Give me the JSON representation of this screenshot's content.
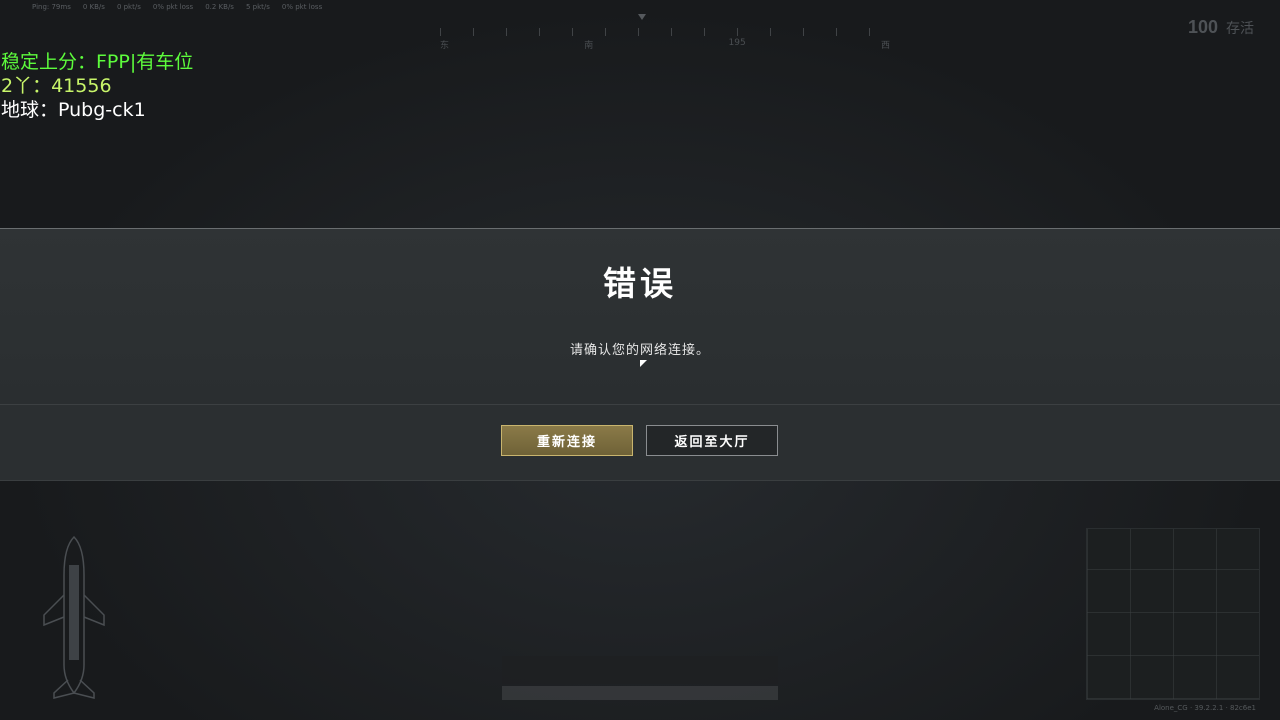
{
  "hud": {
    "netstats": [
      "Ping: 79ms",
      "0 KB/s",
      "0 pkt/s",
      "0% pkt loss",
      "0.2 KB/s",
      "5 pkt/s",
      "0% pkt loss"
    ],
    "compass_labels": [
      "东",
      "",
      "",
      "",
      "",
      "南",
      "195",
      "",
      "",
      "西",
      "",
      ""
    ],
    "alive_count": "100",
    "alive_label": "存活"
  },
  "overlay": {
    "line1": "稳定上分：FPP|有车位",
    "line2": "2丫：41556",
    "line3": "地球：Pubg-ck1"
  },
  "dialog": {
    "title": "错误",
    "message": "请确认您的网络连接。",
    "reconnect_label": "重新连接",
    "lobby_label": "返回至大厅"
  },
  "footer": {
    "version": "Alone_CG · 39.2.2.1 · 82c6e1"
  },
  "colors": {
    "overlay_green": "#5dfc3c",
    "overlay_lime": "#c8f56a",
    "button_gold": "#8a7a48"
  }
}
